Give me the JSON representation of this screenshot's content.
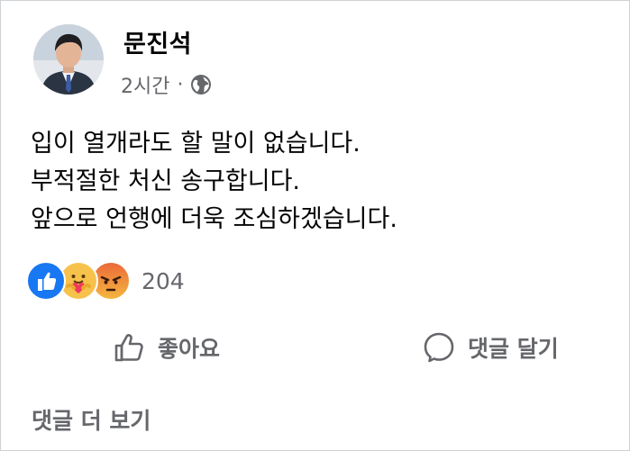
{
  "post": {
    "author": "문진석",
    "time": "2시간",
    "separator": "·",
    "audience_icon": "globe-icon",
    "lines": [
      "입이 열개라도 할 말이 없습니다.",
      "부적절한 처신 송구합니다.",
      "앞으로 언행에 더욱 조심하겠습니다."
    ]
  },
  "reactions": {
    "icons": [
      "like-reaction-icon",
      "care-reaction-icon",
      "angry-reaction-icon"
    ],
    "count": "204"
  },
  "actions": {
    "like_label": "좋아요",
    "comment_label": "댓글 달기"
  },
  "more_comments": "댓글 더 보기",
  "colors": {
    "text": "#050505",
    "muted": "#65676b",
    "like_blue": "#1877f2",
    "care_yellow": "#f7c24b",
    "angry_orange": "#ec6a3a"
  }
}
